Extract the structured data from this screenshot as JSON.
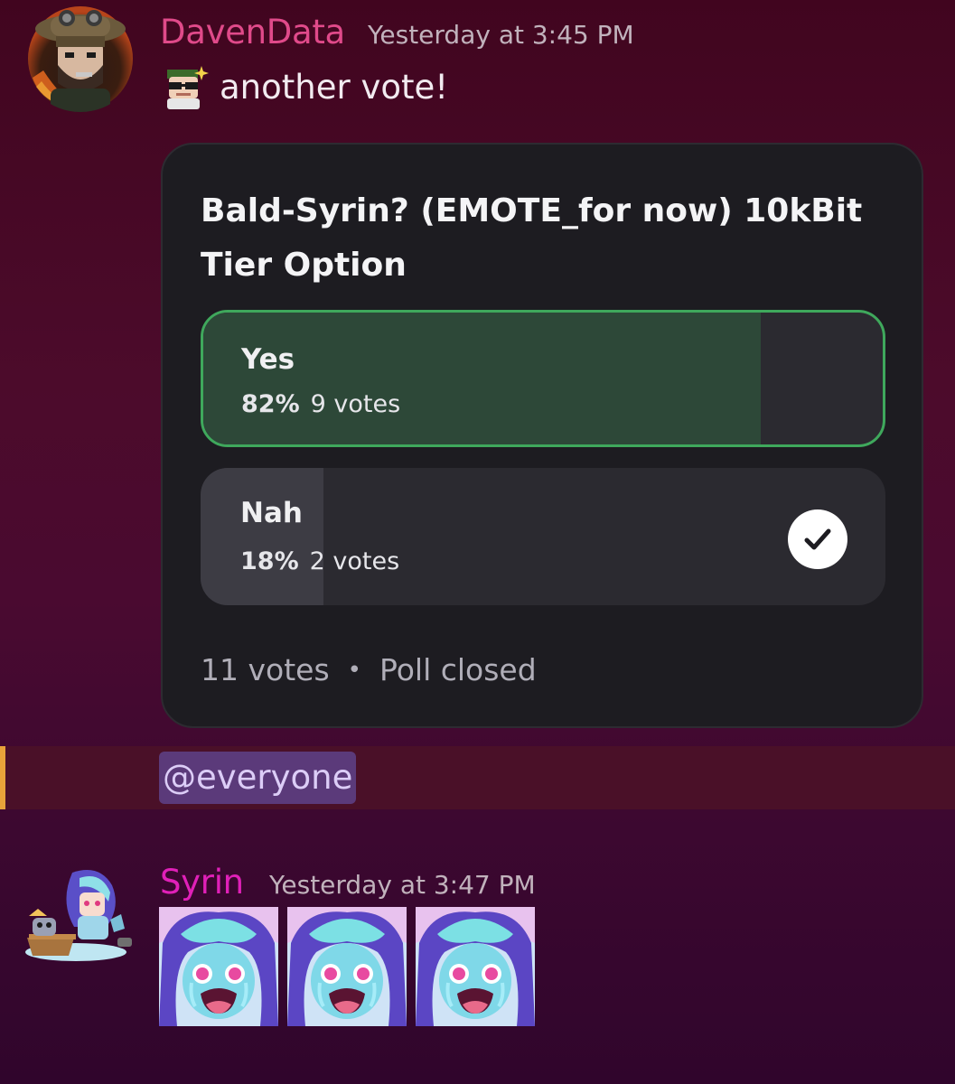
{
  "messages": [
    {
      "author": "DavenData",
      "timestamp": "Yesterday at 3:45 PM",
      "text": "another vote!",
      "author_color": "#e04a8a"
    },
    {
      "author": "Syrin",
      "timestamp": "Yesterday at 3:47 PM",
      "author_color": "#e020b8",
      "sticker_count": 3
    }
  ],
  "poll": {
    "question": "Bald-Syrin? (EMOTE_for now) 10kBit Tier Option",
    "options": [
      {
        "label": "Yes",
        "percent_text": "82%",
        "votes_text": "9 votes",
        "percent": 82,
        "winner": true,
        "selected": false
      },
      {
        "label": "Nah",
        "percent_text": "18%",
        "votes_text": "2 votes",
        "percent": 18,
        "winner": false,
        "selected": true
      }
    ],
    "total_votes": "11 votes",
    "separator": "•",
    "status": "Poll closed",
    "colors": {
      "winner_border": "#3fa85c",
      "winner_fill": "#2d4838",
      "card_bg": "#1d1c21"
    }
  },
  "mention": {
    "text": "@everyone",
    "highlight_color": "#e8a23a"
  },
  "icons": {
    "check": "checkmark-icon",
    "avatar_daven": "avatar",
    "avatar_syrin": "avatar",
    "emoji": "sunglasses-emoji-icon",
    "sticker": "crying-anime-sticker"
  }
}
